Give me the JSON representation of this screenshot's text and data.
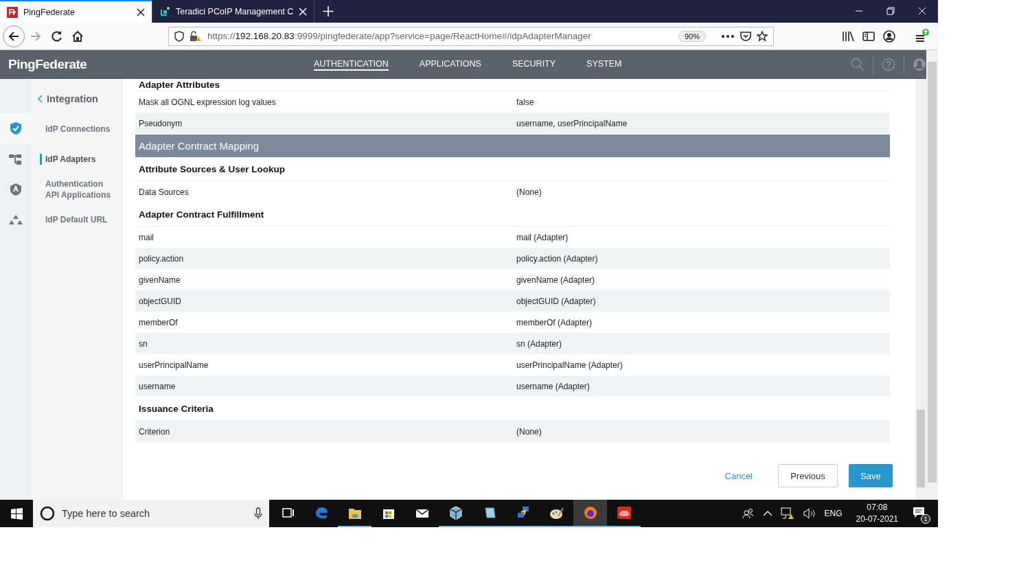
{
  "browser": {
    "tabs": [
      {
        "title": "PingFederate",
        "selected": true
      },
      {
        "title": "Teradici PCoIP Management C",
        "selected": false
      }
    ],
    "url": {
      "scheme": "https://",
      "host": "192.168.20.83",
      "rest": ":9999/pingfederate/app?service=page/ReactHome#/idpAdapterManager"
    },
    "zoom": "90%"
  },
  "app": {
    "logo": "PingFederate",
    "nav": [
      {
        "label": "AUTHENTICATION",
        "selected": true
      },
      {
        "label": "APPLICATIONS",
        "selected": false
      },
      {
        "label": "SECURITY",
        "selected": false
      },
      {
        "label": "SYSTEM",
        "selected": false
      }
    ]
  },
  "sidebar": {
    "back": "Integration",
    "rail": [
      {
        "kind": "shield",
        "selected": true
      },
      {
        "kind": "tree",
        "selected": false
      },
      {
        "kind": "badge",
        "selected": false
      },
      {
        "kind": "cluster",
        "selected": false
      }
    ],
    "items": [
      {
        "label": "IdP Connections",
        "selected": false
      },
      {
        "label": "IdP Adapters",
        "selected": true
      },
      {
        "label": "Authentication API Applications",
        "selected": false
      },
      {
        "label": "IdP Default URL",
        "selected": false
      }
    ]
  },
  "summary": [
    {
      "kind": "heading",
      "label": "Adapter Attributes"
    },
    {
      "kind": "row",
      "label": "Mask all OGNL expression log values",
      "value": "false",
      "shaded": false
    },
    {
      "kind": "row",
      "label": "Pseudonym",
      "value": "username, userPrincipalName",
      "shaded": true
    },
    {
      "kind": "section",
      "label": "Adapter Contract Mapping"
    },
    {
      "kind": "heading",
      "label": "Attribute Sources & User Lookup"
    },
    {
      "kind": "row",
      "label": "Data Sources",
      "value": "(None)",
      "shaded": false
    },
    {
      "kind": "heading",
      "label": "Adapter Contract Fulfillment"
    },
    {
      "kind": "row",
      "label": "mail",
      "value": "mail (Adapter)",
      "shaded": false
    },
    {
      "kind": "row",
      "label": "policy.action",
      "value": "policy.action (Adapter)",
      "shaded": true
    },
    {
      "kind": "row",
      "label": "givenName",
      "value": "givenName (Adapter)",
      "shaded": false
    },
    {
      "kind": "row",
      "label": "objectGUID",
      "value": "objectGUID (Adapter)",
      "shaded": true
    },
    {
      "kind": "row",
      "label": "memberOf",
      "value": "memberOf (Adapter)",
      "shaded": false
    },
    {
      "kind": "row",
      "label": "sn",
      "value": "sn (Adapter)",
      "shaded": true
    },
    {
      "kind": "row",
      "label": "userPrincipalName",
      "value": "userPrincipalName (Adapter)",
      "shaded": false
    },
    {
      "kind": "row",
      "label": "username",
      "value": "username (Adapter)",
      "shaded": true
    },
    {
      "kind": "heading",
      "label": "Issuance Criteria"
    },
    {
      "kind": "row",
      "label": "Criterion",
      "value": "(None)",
      "shaded": true
    }
  ],
  "actions": {
    "cancel": "Cancel",
    "previous": "Previous",
    "save": "Save"
  },
  "taskbar": {
    "search_placeholder": "Type here to search",
    "apps": [
      {
        "kind": "taskview",
        "running": false,
        "selected": false
      },
      {
        "kind": "edge",
        "running": false,
        "selected": false
      },
      {
        "kind": "folder",
        "running": true,
        "selected": false
      },
      {
        "kind": "store",
        "running": false,
        "selected": false
      },
      {
        "kind": "mail",
        "running": false,
        "selected": false
      },
      {
        "kind": "cube",
        "running": true,
        "selected": false
      },
      {
        "kind": "notepad",
        "running": true,
        "selected": false
      },
      {
        "kind": "network",
        "running": true,
        "selected": false
      },
      {
        "kind": "paint",
        "running": true,
        "selected": false
      },
      {
        "kind": "firefox",
        "running": true,
        "selected": true
      },
      {
        "kind": "redhat",
        "running": true,
        "selected": false
      }
    ],
    "language": "ENG",
    "time": "07:08",
    "date": "20-07-2021",
    "notifications": "1"
  }
}
